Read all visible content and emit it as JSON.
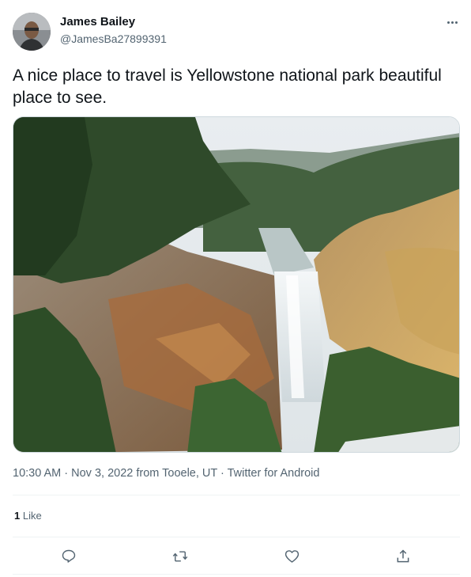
{
  "author": {
    "name": "James Bailey",
    "handle": "@JamesBa27899391"
  },
  "tweet": {
    "text": "A nice place to travel is Yellowstone national park beautiful place to see.",
    "meta": "10:30 AM · Nov 3, 2022 from Tooele, UT · Twitter for Android"
  },
  "engagement": {
    "likes_count": "1",
    "likes_label": "Like"
  },
  "icons": {
    "more": "more-horizontal-icon",
    "reply": "reply-icon",
    "retweet": "retweet-icon",
    "like": "heart-icon",
    "share": "share-icon"
  },
  "colors": {
    "text": "#0f1419",
    "secondary": "#536471",
    "divider": "#eff3f4"
  }
}
